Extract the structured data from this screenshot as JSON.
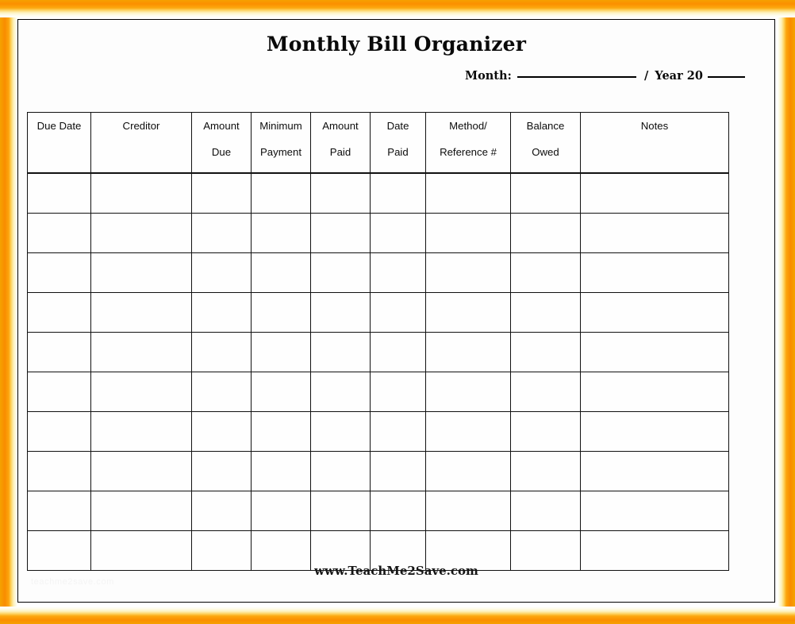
{
  "page": {
    "title": "Monthly Bill Organizer",
    "month_year": {
      "month_label": "Month:",
      "month_value": "",
      "separator": "/",
      "year_label": "Year 20",
      "year_value": ""
    },
    "footer_url": "www.TeachMe2Save.com",
    "watermark": "teachme2save.com"
  },
  "theme": {
    "frame_orange": "#f98c00",
    "frame_cream": "#fdf0b8",
    "page_background": "#fdfdfd",
    "grid_line": "#111111",
    "text": "#0d0d0d"
  },
  "table": {
    "columns": [
      {
        "key": "due_date",
        "line1": "Due Date",
        "line2": ""
      },
      {
        "key": "creditor",
        "line1": "Creditor",
        "line2": ""
      },
      {
        "key": "amount_due",
        "line1": "Amount",
        "line2": "Due"
      },
      {
        "key": "min_payment",
        "line1": "Minimum",
        "line2": "Payment"
      },
      {
        "key": "amount_paid",
        "line1": "Amount",
        "line2": "Paid"
      },
      {
        "key": "date_paid",
        "line1": "Date",
        "line2": "Paid"
      },
      {
        "key": "method_ref",
        "line1": "Method/",
        "line2": "Reference #"
      },
      {
        "key": "balance_owed",
        "line1": "Balance",
        "line2": "Owed"
      },
      {
        "key": "notes",
        "line1": "Notes",
        "line2": ""
      }
    ],
    "row_count": 10,
    "rows": [
      {
        "due_date": "",
        "creditor": "",
        "amount_due": "",
        "min_payment": "",
        "amount_paid": "",
        "date_paid": "",
        "method_ref": "",
        "balance_owed": "",
        "notes": ""
      },
      {
        "due_date": "",
        "creditor": "",
        "amount_due": "",
        "min_payment": "",
        "amount_paid": "",
        "date_paid": "",
        "method_ref": "",
        "balance_owed": "",
        "notes": ""
      },
      {
        "due_date": "",
        "creditor": "",
        "amount_due": "",
        "min_payment": "",
        "amount_paid": "",
        "date_paid": "",
        "method_ref": "",
        "balance_owed": "",
        "notes": ""
      },
      {
        "due_date": "",
        "creditor": "",
        "amount_due": "",
        "min_payment": "",
        "amount_paid": "",
        "date_paid": "",
        "method_ref": "",
        "balance_owed": "",
        "notes": ""
      },
      {
        "due_date": "",
        "creditor": "",
        "amount_due": "",
        "min_payment": "",
        "amount_paid": "",
        "date_paid": "",
        "method_ref": "",
        "balance_owed": "",
        "notes": ""
      },
      {
        "due_date": "",
        "creditor": "",
        "amount_due": "",
        "min_payment": "",
        "amount_paid": "",
        "date_paid": "",
        "method_ref": "",
        "balance_owed": "",
        "notes": ""
      },
      {
        "due_date": "",
        "creditor": "",
        "amount_due": "",
        "min_payment": "",
        "amount_paid": "",
        "date_paid": "",
        "method_ref": "",
        "balance_owed": "",
        "notes": ""
      },
      {
        "due_date": "",
        "creditor": "",
        "amount_due": "",
        "min_payment": "",
        "amount_paid": "",
        "date_paid": "",
        "method_ref": "",
        "balance_owed": "",
        "notes": ""
      },
      {
        "due_date": "",
        "creditor": "",
        "amount_due": "",
        "min_payment": "",
        "amount_paid": "",
        "date_paid": "",
        "method_ref": "",
        "balance_owed": "",
        "notes": ""
      },
      {
        "due_date": "",
        "creditor": "",
        "amount_due": "",
        "min_payment": "",
        "amount_paid": "",
        "date_paid": "",
        "method_ref": "",
        "balance_owed": "",
        "notes": ""
      }
    ]
  }
}
